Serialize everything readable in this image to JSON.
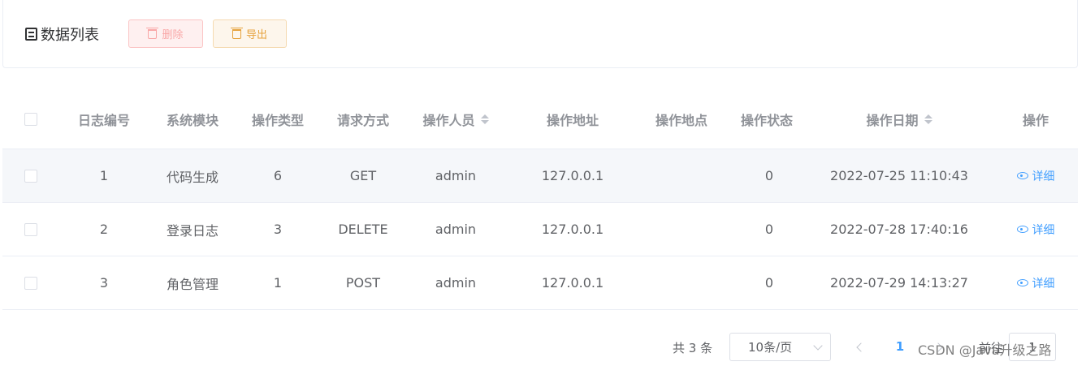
{
  "header": {
    "title": "数据列表",
    "delete_label": "删除",
    "export_label": "导出"
  },
  "table": {
    "columns": [
      "日志编号",
      "系统模块",
      "操作类型",
      "请求方式",
      "操作人员",
      "操作地址",
      "操作地点",
      "操作状态",
      "操作日期",
      "操作"
    ],
    "rows": [
      {
        "id": "1",
        "module": "代码生成",
        "type": "6",
        "method": "GET",
        "operator": "admin",
        "ip": "127.0.0.1",
        "location": "",
        "status": "0",
        "date": "2022-07-25 11:10:43",
        "action": "详细"
      },
      {
        "id": "2",
        "module": "登录日志",
        "type": "3",
        "method": "DELETE",
        "operator": "admin",
        "ip": "127.0.0.1",
        "location": "",
        "status": "0",
        "date": "2022-07-28 17:40:16",
        "action": "详细"
      },
      {
        "id": "3",
        "module": "角色管理",
        "type": "1",
        "method": "POST",
        "operator": "admin",
        "ip": "127.0.0.1",
        "location": "",
        "status": "0",
        "date": "2022-07-29 14:13:27",
        "action": "详细"
      }
    ]
  },
  "pagination": {
    "total_text": "共 3 条",
    "page_size": "10条/页",
    "current_page": "1",
    "goto_label": "前往",
    "jumper_value": "1"
  },
  "watermark": "CSDN @Java升级之路",
  "colors": {
    "primary": "#409eff",
    "danger_plain_bg": "#fef0f0",
    "warning": "#e6a23c",
    "row_highlight": "#f5f7fa"
  },
  "icons": {
    "title": "list-icon",
    "delete": "trash-icon",
    "export": "trash-icon",
    "detail": "eye-icon",
    "sort": "sort-caret-icon"
  }
}
